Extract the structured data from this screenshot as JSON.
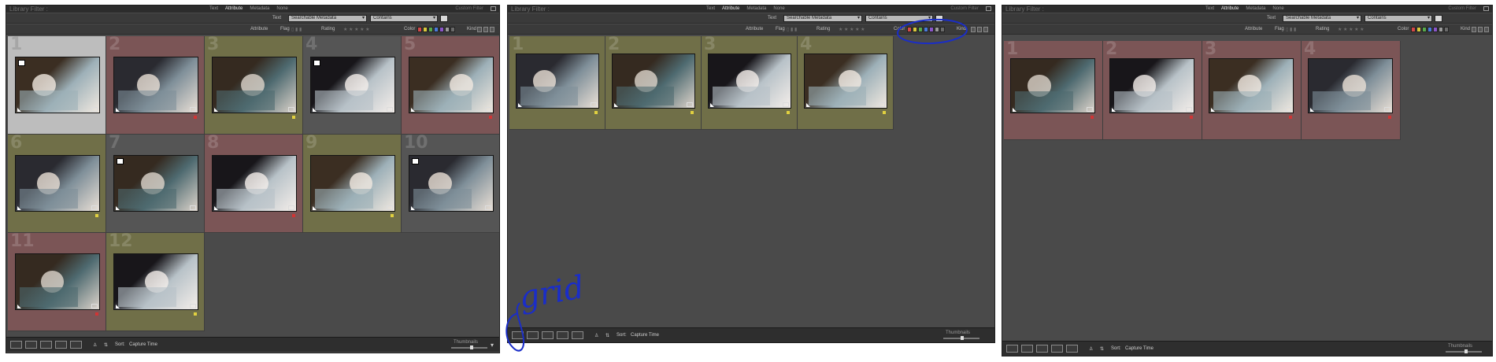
{
  "header": {
    "title": "Library Filter :",
    "tabs": [
      "Text",
      "Attribute",
      "Metadata",
      "None"
    ],
    "active_tab": "Attribute",
    "custom_filter": "Custom Filter"
  },
  "text_filter": {
    "label": "Text",
    "field": "Searchable Metadata",
    "operator": "Contains"
  },
  "attribute_filter": {
    "attribute_label": "Attribute",
    "flag_label": "Flag",
    "rating_label": "Rating",
    "color_label": "Color",
    "kind_label": "Kind",
    "color_swatches": [
      "#d24848",
      "#d8c83c",
      "#57a84c",
      "#4a7ad8",
      "#8a55c8",
      "#9a9a9a",
      "#6a6a6a"
    ]
  },
  "toolbar": {
    "sort_label": "Sort:",
    "sort_value": "Capture Time",
    "thumbnails_label": "Thumbnails"
  },
  "annotation": {
    "handwritten_text": "grid",
    "circle_color": "#1a2dc8"
  },
  "panels": [
    {
      "id": "all",
      "cells": [
        {
          "index": "1",
          "label": "none",
          "selected": true,
          "badge": true,
          "flag": false
        },
        {
          "index": "2",
          "label": "red",
          "selected": false,
          "badge": false,
          "flag": true
        },
        {
          "index": "3",
          "label": "yellow",
          "selected": false,
          "badge": false,
          "flag": true
        },
        {
          "index": "4",
          "label": "none",
          "selected": false,
          "badge": true,
          "flag": false
        },
        {
          "index": "5",
          "label": "red",
          "selected": false,
          "badge": false,
          "flag": true
        },
        {
          "index": "6",
          "label": "yellow",
          "selected": false,
          "badge": false,
          "flag": true
        },
        {
          "index": "7",
          "label": "none",
          "selected": false,
          "badge": true,
          "flag": false
        },
        {
          "index": "8",
          "label": "red",
          "selected": false,
          "badge": false,
          "flag": true
        },
        {
          "index": "9",
          "label": "yellow",
          "selected": false,
          "badge": false,
          "flag": true
        },
        {
          "index": "10",
          "label": "none",
          "selected": false,
          "badge": true,
          "flag": false
        },
        {
          "index": "11",
          "label": "red",
          "selected": false,
          "badge": false,
          "flag": true
        },
        {
          "index": "12",
          "label": "yellow",
          "selected": false,
          "badge": false,
          "flag": true
        }
      ]
    },
    {
      "id": "yellow",
      "cells": [
        {
          "index": "1",
          "label": "yellow",
          "selected": false,
          "badge": false,
          "flag": true
        },
        {
          "index": "2",
          "label": "yellow",
          "selected": false,
          "badge": false,
          "flag": true
        },
        {
          "index": "3",
          "label": "yellow",
          "selected": false,
          "badge": false,
          "flag": true
        },
        {
          "index": "4",
          "label": "yellow",
          "selected": false,
          "badge": false,
          "flag": true
        }
      ]
    },
    {
      "id": "red",
      "cells": [
        {
          "index": "1",
          "label": "red",
          "selected": false,
          "badge": false,
          "flag": true
        },
        {
          "index": "2",
          "label": "red",
          "selected": false,
          "badge": false,
          "flag": true
        },
        {
          "index": "3",
          "label": "red",
          "selected": false,
          "badge": false,
          "flag": true
        },
        {
          "index": "4",
          "label": "red",
          "selected": false,
          "badge": false,
          "flag": true
        }
      ]
    }
  ]
}
